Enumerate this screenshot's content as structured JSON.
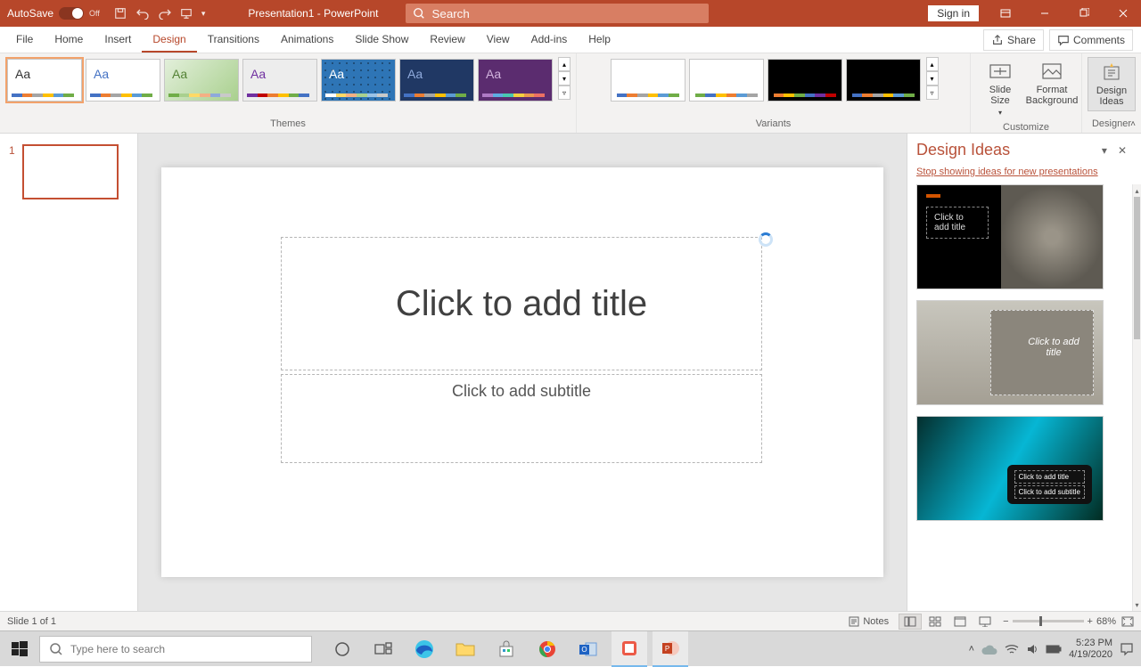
{
  "titlebar": {
    "autosave_label": "AutoSave",
    "autosave_state": "Off",
    "doc_title": "Presentation1 - PowerPoint",
    "search_placeholder": "Search",
    "signin_label": "Sign in"
  },
  "tabs": {
    "items": [
      "File",
      "Home",
      "Insert",
      "Design",
      "Transitions",
      "Animations",
      "Slide Show",
      "Review",
      "View",
      "Add-ins",
      "Help"
    ],
    "active_index": 3,
    "share": "Share",
    "comments": "Comments"
  },
  "ribbon": {
    "themes_label": "Themes",
    "variants_label": "Variants",
    "customize_label": "Customize",
    "designer_label": "Designer",
    "slide_size": "Slide Size",
    "format_bg": "Format Background",
    "design_ideas": "Design Ideas",
    "aa": "Aa"
  },
  "theme_colors": [
    {
      "bg": "#ffffff",
      "fg": "#333333",
      "stripe": [
        "#4472c4",
        "#ed7d31",
        "#a5a5a5",
        "#ffc000",
        "#5b9bd5",
        "#70ad47"
      ]
    },
    {
      "bg": "#ffffff",
      "fg": "#4472c4",
      "stripe": [
        "#4472c4",
        "#ed7d31",
        "#a5a5a5",
        "#ffc000",
        "#5b9bd5",
        "#70ad47"
      ]
    },
    {
      "bg": "#e2efda",
      "fg": "#548235",
      "stripe": [
        "#70ad47",
        "#a9d08e",
        "#ffd966",
        "#f4b084",
        "#8ea9db",
        "#c9c9c9"
      ],
      "grad": "linear-gradient(135deg,#e2efda,#a9d08e)"
    },
    {
      "bg": "#ededed",
      "fg": "#7030a0",
      "stripe": [
        "#7030a0",
        "#c00000",
        "#ed7d31",
        "#ffc000",
        "#70ad47",
        "#4472c4"
      ]
    },
    {
      "bg": "#2e75b6",
      "fg": "#ffffff",
      "stripe": [
        "#ffffff",
        "#ffd966",
        "#f4b084",
        "#a9d08e",
        "#9bc2e6",
        "#c9c9c9"
      ],
      "pat": true
    },
    {
      "bg": "#203864",
      "fg": "#8faadc",
      "stripe": [
        "#4472c4",
        "#ed7d31",
        "#a5a5a5",
        "#ffc000",
        "#5b9bd5",
        "#70ad47"
      ]
    },
    {
      "bg": "#5b2c6f",
      "fg": "#d2b4de",
      "stripe": [
        "#af7ac5",
        "#5dade2",
        "#48c9b0",
        "#f4d03f",
        "#eb984e",
        "#ec7063"
      ]
    }
  ],
  "variant_colors": [
    {
      "bg": "#ffffff",
      "stripe": [
        "#4472c4",
        "#ed7d31",
        "#a5a5a5",
        "#ffc000",
        "#5b9bd5",
        "#70ad47"
      ]
    },
    {
      "bg": "#ffffff",
      "stripe": [
        "#70ad47",
        "#4472c4",
        "#ffc000",
        "#ed7d31",
        "#5b9bd5",
        "#a5a5a5"
      ]
    },
    {
      "bg": "#000000",
      "stripe": [
        "#ed7d31",
        "#ffc000",
        "#70ad47",
        "#4472c4",
        "#7030a0",
        "#c00000"
      ]
    },
    {
      "bg": "#000000",
      "stripe": [
        "#4472c4",
        "#ed7d31",
        "#a5a5a5",
        "#ffc000",
        "#5b9bd5",
        "#70ad47"
      ]
    }
  ],
  "thumbs": {
    "slides": [
      {
        "num": "1"
      }
    ]
  },
  "slide": {
    "title_placeholder": "Click to add title",
    "subtitle_placeholder": "Click to add subtitle"
  },
  "pane": {
    "title": "Design Ideas",
    "stop_link": "Stop showing ideas for new presentations",
    "idea_title": "Click to add title",
    "idea_sub": "Click to add subtitle"
  },
  "status": {
    "slide_indicator": "Slide 1 of 1",
    "notes": "Notes",
    "zoom": "68%"
  },
  "taskbar": {
    "search_placeholder": "Type here to search",
    "time": "5:23 PM",
    "date": "4/19/2020"
  }
}
